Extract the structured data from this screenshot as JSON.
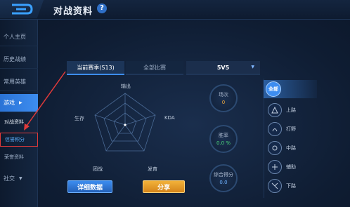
{
  "header": {
    "title": "对战资料",
    "help_glyph": "?"
  },
  "sidebar": {
    "items": [
      {
        "label": "个人主页"
      },
      {
        "label": "历史战绩"
      },
      {
        "label": "常用英雄"
      },
      {
        "label": "游戏",
        "chevron": "▶"
      }
    ],
    "subitems": [
      {
        "label": "对战资料"
      },
      {
        "label": "信誉积分"
      },
      {
        "label": "荣誉资料"
      }
    ],
    "social": {
      "label": "社交",
      "chevron": "▼"
    }
  },
  "tabs": {
    "season": "当前赛季(S13)",
    "all": "全部比赛",
    "mode": "5V5",
    "mode_chevron": "▼"
  },
  "radar": {
    "axes": [
      "输出",
      "KDA",
      "发育",
      "团战",
      "生存"
    ]
  },
  "stats": [
    {
      "label": "场次",
      "value": "0",
      "color": "#f3a93a"
    },
    {
      "label": "胜率",
      "value": "0.0 %",
      "color": "#4bd47a"
    },
    {
      "label": "综合得分",
      "value": "0.0",
      "color": "#6db0ff"
    }
  ],
  "buttons": {
    "detail": "详细数据",
    "share": "分享"
  },
  "roles": [
    {
      "label": "全部",
      "icon": "all-icon"
    },
    {
      "label": "上路",
      "icon": "top-lane-icon"
    },
    {
      "label": "打野",
      "icon": "jungle-icon"
    },
    {
      "label": "中路",
      "icon": "mid-lane-icon"
    },
    {
      "label": "辅助",
      "icon": "support-icon"
    },
    {
      "label": "下路",
      "icon": "bot-lane-icon"
    }
  ],
  "colors": {
    "accent": "#3d8df0",
    "share": "#f3b23a",
    "annotation": "#e03a3a"
  }
}
